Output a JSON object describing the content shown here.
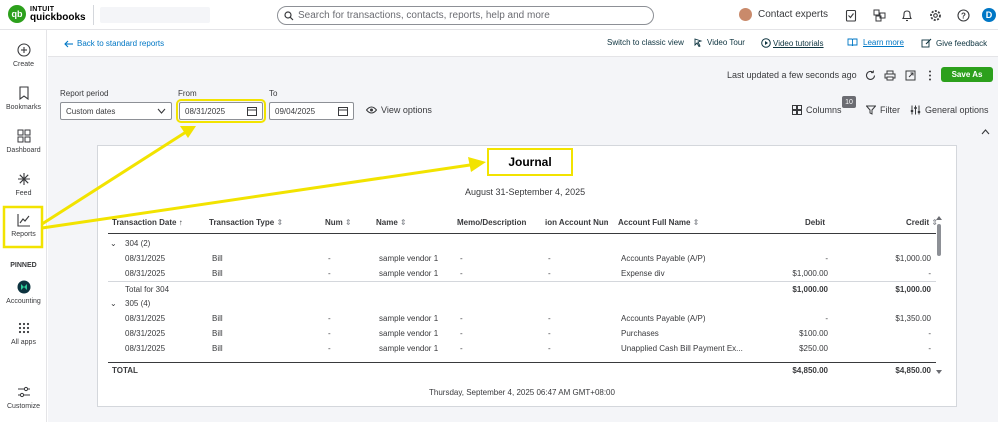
{
  "topbar": {
    "logo_line1": "INTUIT",
    "logo_line2": "quickbooks",
    "search_placeholder": "Search for transactions, contacts, reports, help and more",
    "contact_label": "Contact experts",
    "user_initial": "D"
  },
  "leftnav": {
    "create": "Create",
    "bookmarks": "Bookmarks",
    "dashboard": "Dashboard",
    "feed": "Feed",
    "reports": "Reports",
    "pinned": "PINNED",
    "accounting": "Accounting",
    "all_apps": "All apps",
    "customize": "Customize"
  },
  "subbar": {
    "back": "Back to standard reports",
    "classic": "Switch to classic view",
    "video_tour": "Video Tour",
    "video_tutorials": "Video tutorials",
    "learn_more": "Learn more",
    "feedback": "Give feedback"
  },
  "actions": {
    "last_updated": "Last updated a few seconds ago",
    "save_as": "Save As"
  },
  "filters": {
    "period_label": "Report period",
    "period_value": "Custom dates",
    "from_label": "From",
    "from_value": "08/31/2025",
    "to_label": "To",
    "to_value": "09/04/2025",
    "view_options": "View options",
    "columns": "Columns",
    "columns_badge": "10",
    "filter": "Filter",
    "general_options": "General options"
  },
  "report": {
    "title": "Journal",
    "subtitle": "August 31-September 4, 2025",
    "columns": [
      "Transaction Date",
      "Transaction Type",
      "Num",
      "Name",
      "Memo/Description",
      "ion Account Num",
      "Account Full Name",
      "Debit",
      "Credit"
    ],
    "group1": {
      "label": "304 (2)",
      "rows": [
        [
          "08/31/2025",
          "Bill",
          "-",
          "sample vendor 1",
          "-",
          "-",
          "Accounts Payable (A/P)",
          "-",
          "$1,000.00"
        ],
        [
          "08/31/2025",
          "Bill",
          "-",
          "sample vendor 1",
          "-",
          "-",
          "Expense div",
          "$1,000.00",
          "-"
        ]
      ],
      "total_label": "Total for 304",
      "total_debit": "$1,000.00",
      "total_credit": "$1,000.00"
    },
    "group2": {
      "label": "305 (4)",
      "rows": [
        [
          "08/31/2025",
          "Bill",
          "-",
          "sample vendor 1",
          "-",
          "-",
          "Accounts Payable (A/P)",
          "-",
          "$1,350.00"
        ],
        [
          "08/31/2025",
          "Bill",
          "-",
          "sample vendor 1",
          "-",
          "-",
          "Purchases",
          "$100.00",
          "-"
        ],
        [
          "08/31/2025",
          "Bill",
          "-",
          "sample vendor 1",
          "-",
          "-",
          "Unapplied Cash Bill Payment Ex...",
          "$250.00",
          "-"
        ]
      ]
    },
    "grand_total_label": "TOTAL",
    "grand_debit": "$4,850.00",
    "grand_credit": "$4,850.00",
    "timestamp": "Thursday, September 4, 2025 06:47 AM GMT+08:00"
  },
  "colors": {
    "brand_green": "#2ca01c",
    "link_blue": "#0077c5",
    "annotation_yellow": "#f2e300"
  }
}
